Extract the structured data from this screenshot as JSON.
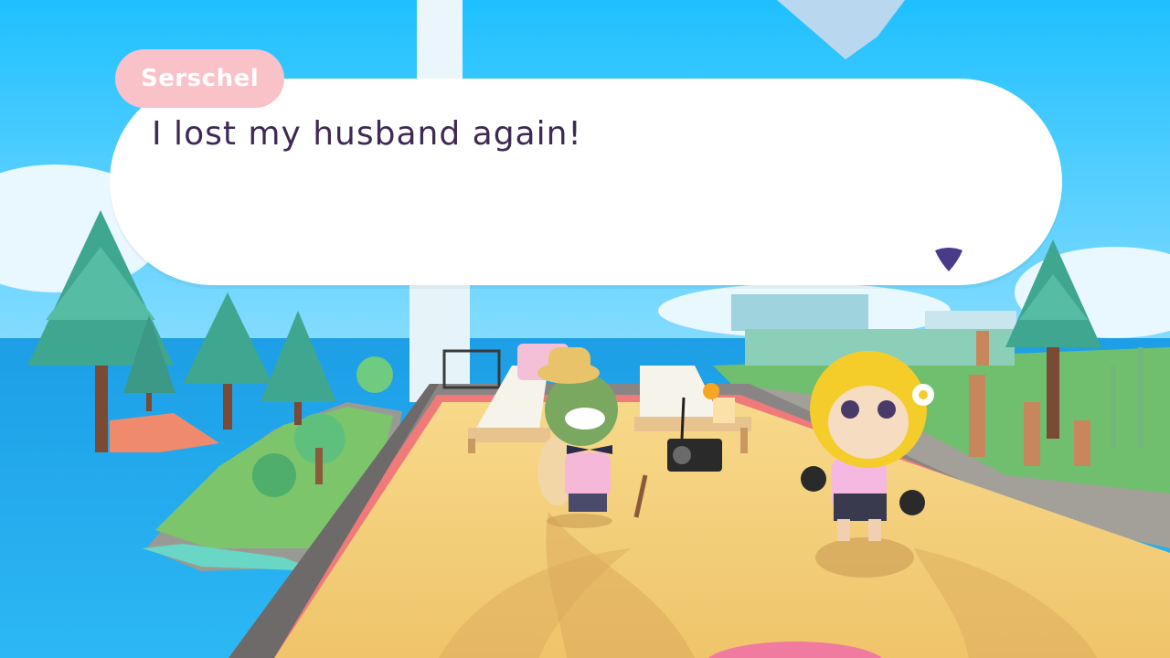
{
  "dialogue": {
    "speaker": "Serschel",
    "text": "I lost my husband again!",
    "advance_icon": "triangle-down-icon"
  },
  "colors": {
    "sky": "#28b8f0",
    "sea": "#1fb3ef",
    "sand": "#f3c56a",
    "nametag": "#f9c2c8",
    "dialogue_text": "#3e2a55",
    "advance": "#4a3a8a"
  }
}
